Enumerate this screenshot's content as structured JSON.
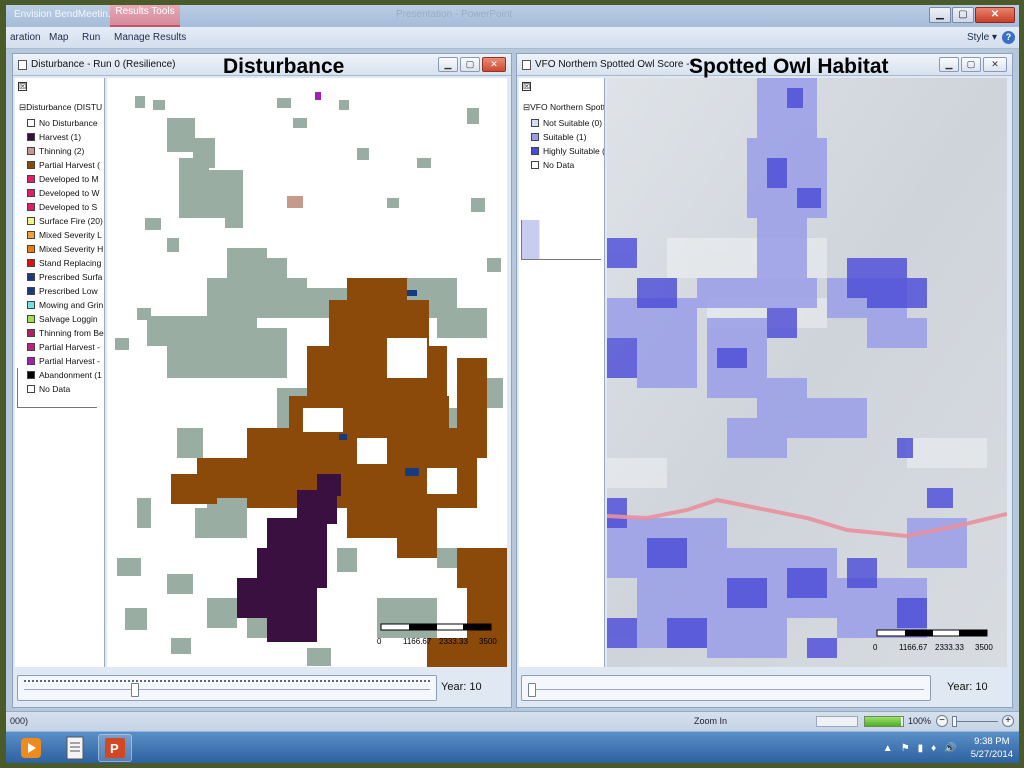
{
  "app": {
    "title": "Envision BendMeetin...",
    "context_tab": "Results Tools",
    "document_title": "Presentation - PowerPoint"
  },
  "window_controls": {
    "minimize": "▁",
    "maximize": "▢",
    "close": "✕"
  },
  "ribbon": {
    "tabs": [
      "aration",
      "Map",
      "Run",
      "Manage Results"
    ],
    "style_label": "Style ▾",
    "help": "?"
  },
  "left_window": {
    "title": "Disturbance - Run 0 (Resilience)",
    "overlay_title": "Disturbance",
    "legend_toggle": "☒",
    "legend_header": "⊟Disturbance (DISTU",
    "legend_items": [
      {
        "label": "No Disturbance",
        "color": "#ffffff"
      },
      {
        "label": "Harvest (1)",
        "color": "#3a1040"
      },
      {
        "label": "Thinning (2)",
        "color": "#c49a8a"
      },
      {
        "label": "Partial Harvest (",
        "color": "#8b4a0a"
      },
      {
        "label": "Developed to M",
        "color": "#e0206a"
      },
      {
        "label": "Developed to W",
        "color": "#e0206a"
      },
      {
        "label": "Developed to S",
        "color": "#e0206a"
      },
      {
        "label": "Surface Fire (20)",
        "color": "#f4f08a"
      },
      {
        "label": "Mixed Severity L",
        "color": "#f0a040"
      },
      {
        "label": "Mixed Severity H",
        "color": "#f07a10"
      },
      {
        "label": "Stand Replacing",
        "color": "#e01010"
      },
      {
        "label": "Prescribed Surfa",
        "color": "#1a3a80"
      },
      {
        "label": "Prescribed Low",
        "color": "#1a3a80"
      },
      {
        "label": "Mowing and Grin",
        "color": "#70e0e0"
      },
      {
        "label": "Salvage Loggin",
        "color": "#a0e050"
      },
      {
        "label": "Thinning from Be",
        "color": "#b02060"
      },
      {
        "label": "Partial Harvest -",
        "color": "#c02080"
      },
      {
        "label": "Partial Harvest -",
        "color": "#a020b0"
      },
      {
        "label": "Abandonment (1",
        "color": "#000000"
      },
      {
        "label": "No Data",
        "color": "#ffffff"
      }
    ],
    "scale_labels": [
      "0",
      "1166.67",
      "2333.33",
      "3500"
    ],
    "year_label": "Year: 10",
    "slider_fraction": 0.27
  },
  "right_window": {
    "title": "VFO Northern Spotted Owl Score - Run 0 (Resilience)",
    "overlay_title": "Spotted Owl Habitat",
    "legend_toggle": "☒",
    "legend_header": "⊟VFO Northern Spott",
    "legend_items": [
      {
        "label": "Not Suitable (0)",
        "color": "#d8dcf4"
      },
      {
        "label": "Suitable (1)",
        "color": "#9a9ee8"
      },
      {
        "label": "Highly Suitable (",
        "color": "#4a4ad8"
      },
      {
        "label": "No Data",
        "color": "#ffffff"
      }
    ],
    "scale_labels": [
      "0",
      "1166.67",
      "2333.33",
      "3500"
    ],
    "year_label": "Year: 10",
    "slider_fraction": 0.0
  },
  "status_bar": {
    "left_text": "000)",
    "zoom_in_label": "Zoom In",
    "zoom_percent": "100%",
    "progress_fraction": 0.95
  },
  "taskbar": {
    "apps": [
      "media-player",
      "document",
      "powerpoint"
    ],
    "time": "9:38 PM",
    "date": "5/27/2014",
    "tray_icons": [
      "▲",
      "⚑",
      "▮",
      "♦",
      "🔊"
    ]
  }
}
